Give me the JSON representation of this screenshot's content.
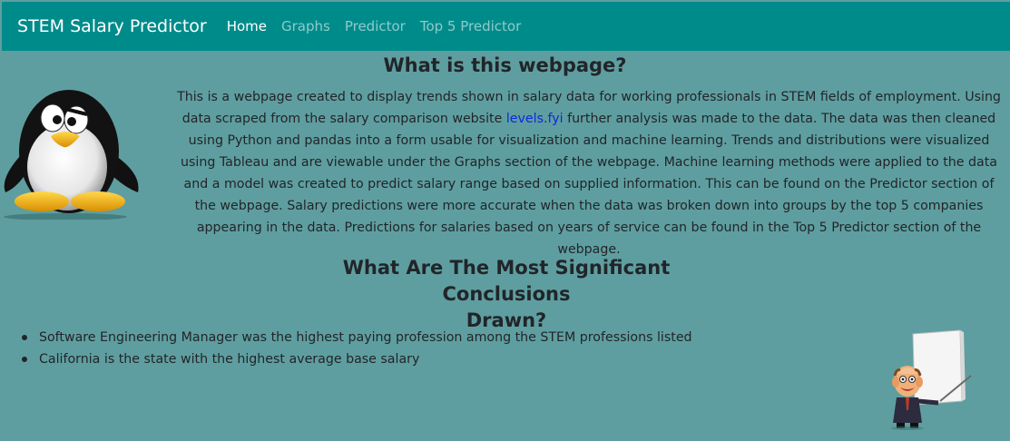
{
  "nav": {
    "brand": "STEM Salary Predictor",
    "links": [
      {
        "label": "Home",
        "active": true
      },
      {
        "label": "Graphs",
        "active": false
      },
      {
        "label": "Predictor",
        "active": false
      },
      {
        "label": "Top 5 Predictor",
        "active": false
      }
    ]
  },
  "intro": {
    "title": "What is this webpage?",
    "text_before_link": "This is a webpage created to display trends shown in salary data for working professionals in STEM fields of employment. Using data scraped from the salary comparison website ",
    "link_text": "levels.fyi",
    "text_after_link": " further analysis was made to the data. The data was then cleaned using Python and pandas into a form usable for visualization and machine learning. Trends and distributions were visualized using Tableau and are viewable under the Graphs section of the webpage. Machine learning methods were applied to the data and a model was created to predict salary range based on supplied information. This can be found on the Predictor section of the webpage. Salary predictions were more accurate when the data was broken down into groups by the top 5 companies appearing in the data. Predictions for salaries based on years of service can be found in the Top 5 Predictor section of the webpage."
  },
  "conclusions": {
    "title_line1": "What Are The Most Significant Conclusions",
    "title_line2": "Drawn?",
    "items": [
      "Software Engineering Manager was the highest paying profession among the STEM professions listed",
      "California is the state with the highest average base salary"
    ]
  },
  "colors": {
    "background": "#5f9ea0",
    "navbar": "#008b8b",
    "link": "#0d2ad8"
  },
  "images": {
    "left": "penguin-mascot",
    "right": "presenter-cartoon"
  }
}
